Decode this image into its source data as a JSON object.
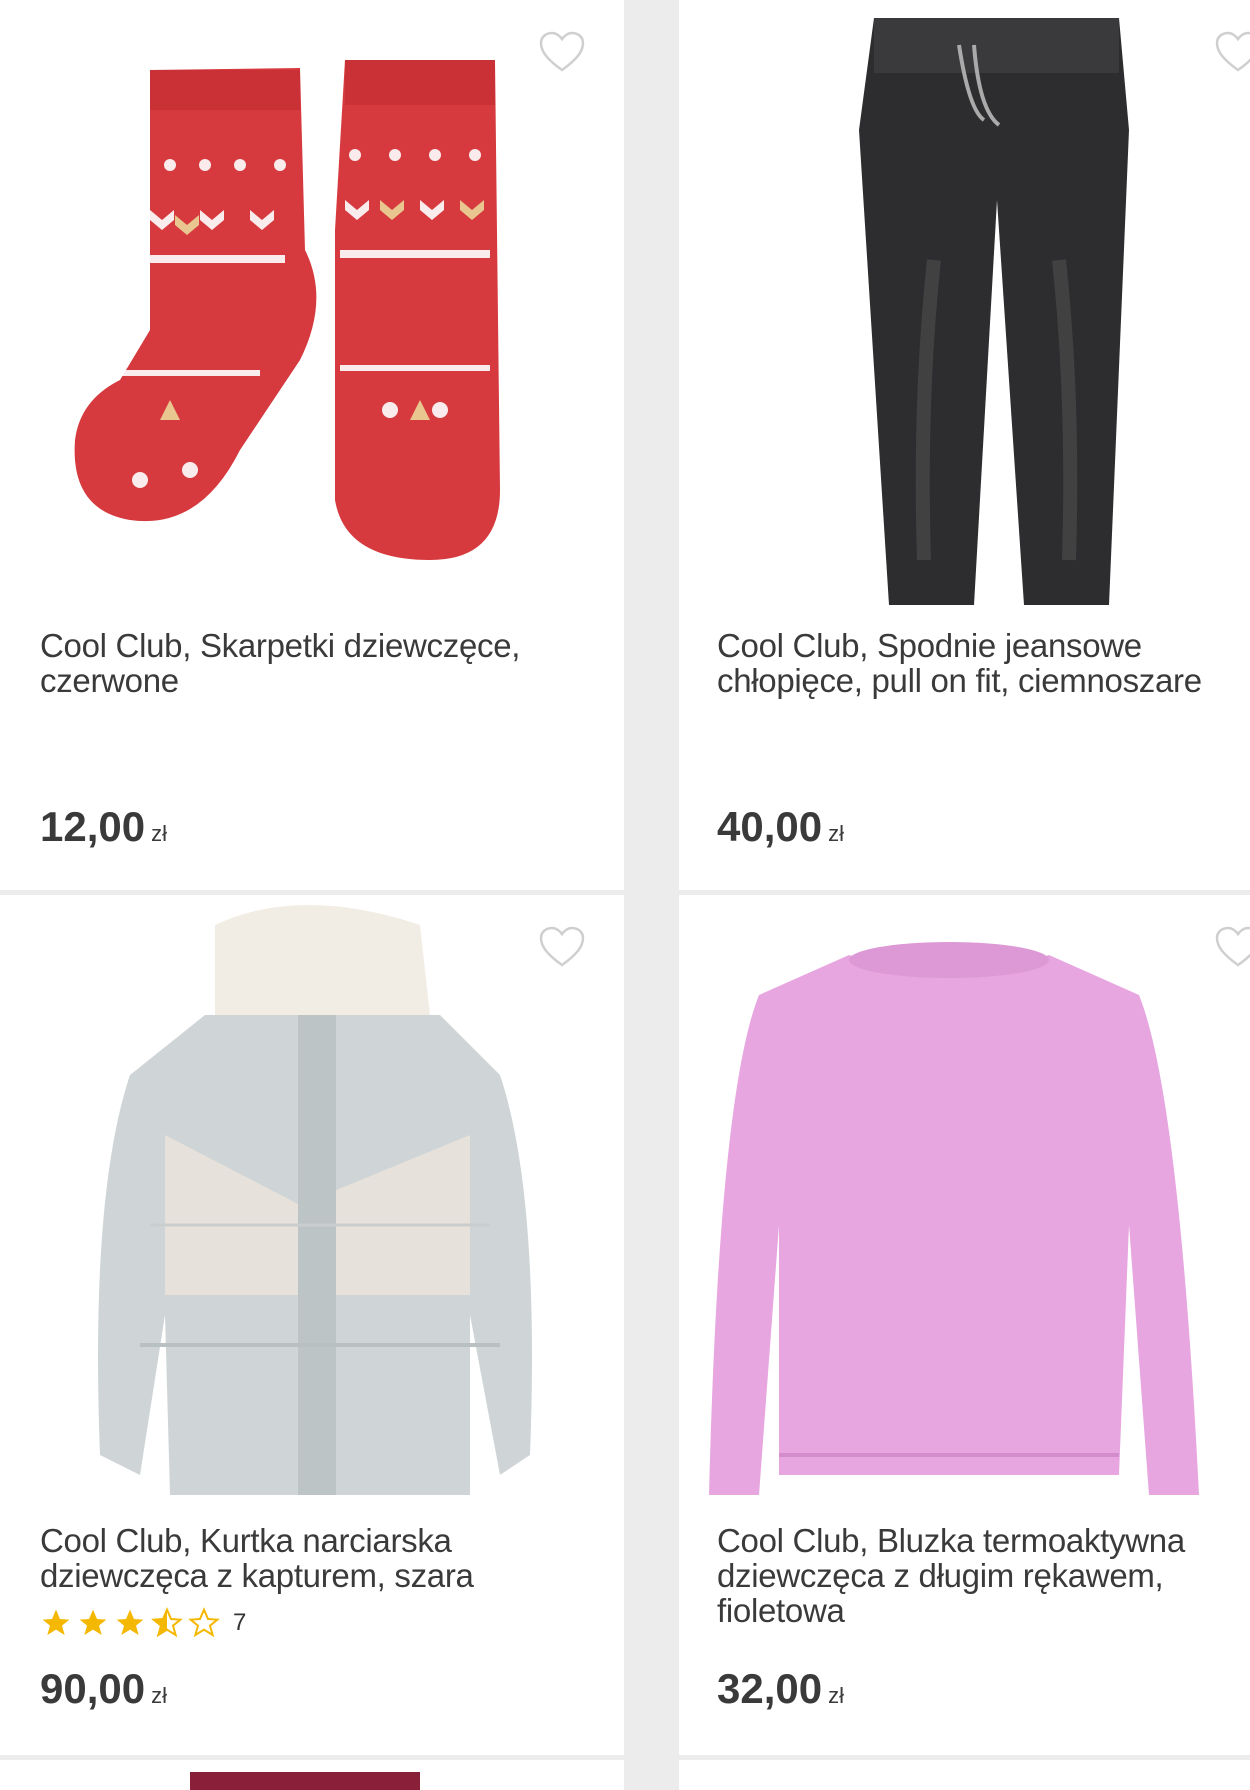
{
  "products": [
    {
      "title": "Cool Club, Skarpetki dziewczęce, czerwone",
      "price": "12,00",
      "currency": "zł",
      "image": "red-christmas-socks"
    },
    {
      "title": "Cool Club, Spodnie jeansowe chłopięce, pull on fit, ciemnoszare",
      "price": "40,00",
      "currency": "zł",
      "image": "dark-grey-jeans"
    },
    {
      "title": "Cool Club, Kurtka narciarska dziewczęca z kapturem, szara",
      "price": "90,00",
      "currency": "zł",
      "image": "grey-ski-jacket",
      "rating": {
        "stars": 3.5,
        "max": 5,
        "count": "7"
      }
    },
    {
      "title": "Cool Club, Bluzka termoaktywna dziewczęca z długim rękawem, fioletowa",
      "price": "32,00",
      "currency": "zł",
      "image": "violet-long-sleeve-top"
    }
  ],
  "colors": {
    "star": "#f5b800",
    "text": "#3a3a3a",
    "background": "#ececec"
  }
}
